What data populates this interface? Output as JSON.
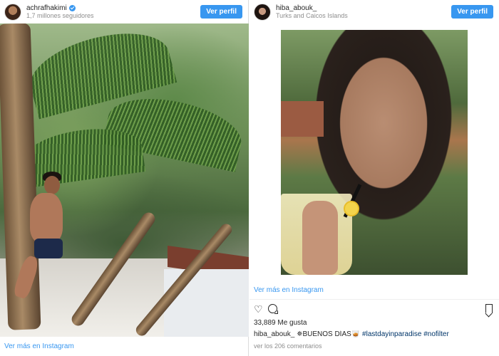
{
  "left_post": {
    "username": "achrafhakimi",
    "followers": "1,7 millones seguidores",
    "view_profile": "Ver perfil",
    "view_more": "Ver más en Instagram"
  },
  "right_post": {
    "username": "hiba_abouk_",
    "location": "Turks and Caicos Islands",
    "view_profile": "Ver perfil",
    "view_more": "Ver más en Instagram",
    "likes": "33,889 Me gusta",
    "caption_user": "hiba_abouk_",
    "caption_text": "✵BUENOS DÍAS🥃",
    "caption_tag1": "#lastdayinparadise",
    "caption_tag2": "#nofilter",
    "comments": "ver los 206 comentarios"
  },
  "icons": [
    "verified-badge-icon",
    "heart-icon",
    "comment-icon",
    "bookmark-icon"
  ],
  "colors": {
    "accent": "#3897f0",
    "text": "#262626",
    "muted": "#8e8e8e"
  }
}
